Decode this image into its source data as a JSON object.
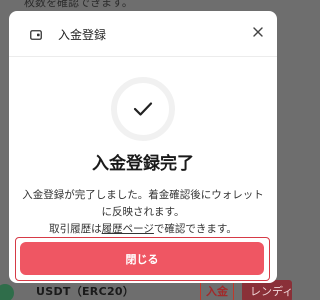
{
  "background": {
    "top_text": "枚数を確認できます。",
    "asset_row": {
      "coin_name": "USDT（ERC20）",
      "deposit_button": "入金",
      "lending_button": "レンディ"
    }
  },
  "modal": {
    "title": "入金登録",
    "heading": "入金登録完了",
    "message_line1": "入金登録が完了しました。着金確認後にウォレット",
    "message_line2": "に反映されます。",
    "message_line3_prefix": "取引履歴は",
    "message_line3_link": "履歴ページ",
    "message_line3_suffix": "で確認できます。",
    "close_button": "閉じる"
  },
  "colors": {
    "accent": "#ef5663",
    "highlight_border": "#d63a46"
  },
  "icons": [
    "wallet-icon",
    "close-icon",
    "check-icon",
    "coin-icon"
  ]
}
